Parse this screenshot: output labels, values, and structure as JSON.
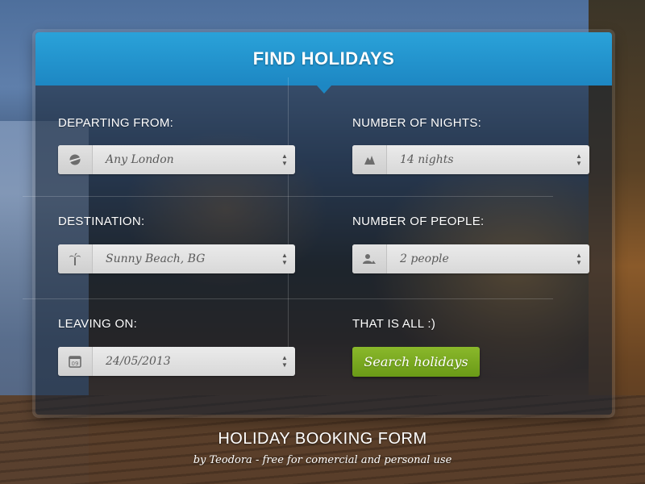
{
  "form": {
    "title": "FIND HOLIDAYS",
    "departing": {
      "label": "DEPARTING FROM:",
      "value": "Any London",
      "icon": "plane-globe-icon"
    },
    "nights": {
      "label": "NUMBER OF NIGHTS:",
      "value": "14 nights",
      "icon": "moon-night-icon"
    },
    "destination": {
      "label": "DESTINATION:",
      "value": "Sunny Beach, BG",
      "icon": "palm-tree-icon"
    },
    "people": {
      "label": "NUMBER OF PEOPLE:",
      "value": "2 people",
      "icon": "people-icon"
    },
    "leaving": {
      "label": "LEAVING ON:",
      "value": "24/05/2013",
      "icon": "calendar-icon",
      "icon_text": "09"
    },
    "submit": {
      "label": "THAT IS ALL :)",
      "button": "Search holidays"
    }
  },
  "footer": {
    "title": "HOLIDAY BOOKING FORM",
    "subtitle": "by Teodora - free for comercial and personal use"
  },
  "colors": {
    "header": "#1d87c3",
    "button": "#7aa820"
  }
}
